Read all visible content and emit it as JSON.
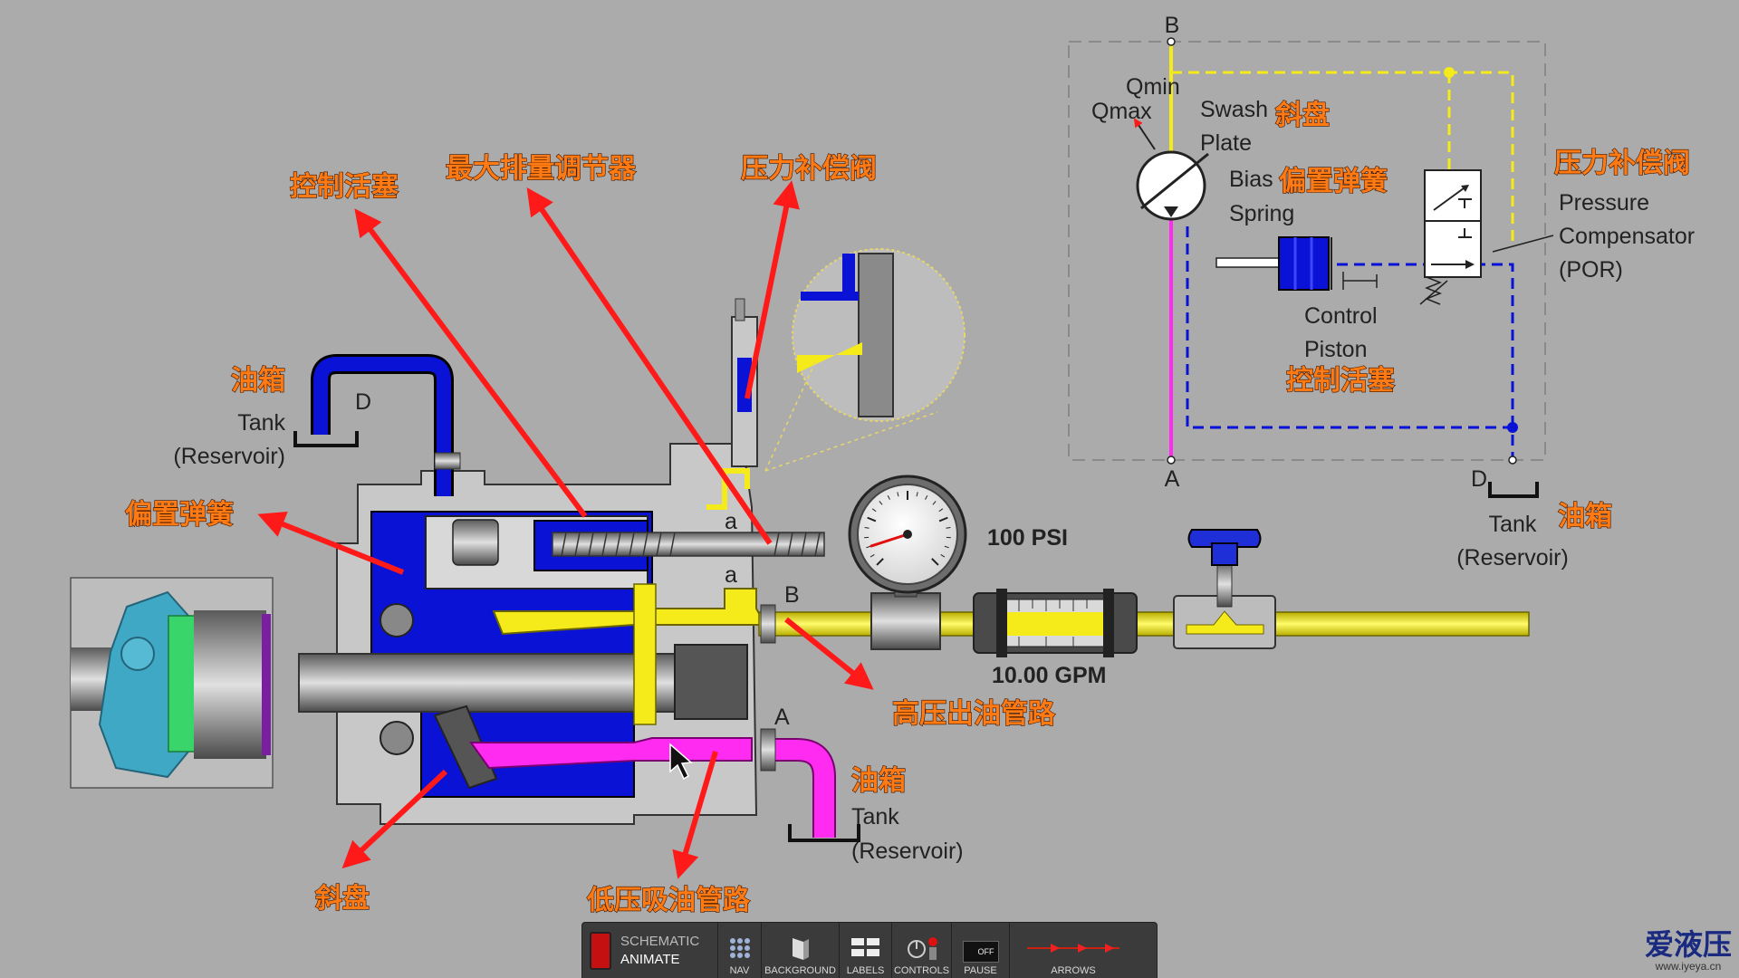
{
  "schematic": {
    "port_b": "B",
    "q_min": "Qmin",
    "q_max": "Qmax",
    "swash_plate_line1": "Swash",
    "swash_plate_line2": "Plate",
    "bias_spring_line1": "Bias",
    "bias_spring_line2": "Spring",
    "control_piston_line1": "Control",
    "control_piston_line2": "Piston",
    "compensator_line1": "Pressure",
    "compensator_line2": "Compensator",
    "compensator_line3": "(POR)",
    "port_a": "A",
    "port_d": "D",
    "tank_line1": "Tank",
    "tank_line2": "(Reservoir)"
  },
  "labels_cn": {
    "swash_plate": "斜盘",
    "bias_spring": "偏置弹簧",
    "control_piston": "控制活塞",
    "compensator": "压力补偿阀",
    "max_displacement": "最大排量调节器",
    "tank": "油箱",
    "high_pressure_line": "高压出油管路",
    "low_pressure_line": "低压吸油管路"
  },
  "pump": {
    "tank_port": "D",
    "tank_line1": "Tank",
    "tank_line2": "(Reservoir)",
    "port_b": "B",
    "port_a": "A",
    "port_a_small": "a",
    "port_a_small2": "a",
    "outlet_tank_line1": "Tank",
    "outlet_tank_line2": "(Reservoir)"
  },
  "gauge": {
    "pressure_text": "100 PSI",
    "psi": 100
  },
  "flowmeter": {
    "flow_text": "10.00 GPM"
  },
  "toolbar": {
    "schematic": "SCHEMATIC",
    "animate": "ANIMATE",
    "nav": "NAV",
    "background": "BACKGROUND",
    "labels": "LABELS",
    "controls": "CONTROLS",
    "pause": "PAUSE",
    "pause_state": "OFF",
    "arrows": "ARROWS"
  },
  "branding": {
    "logo": "爱液压",
    "url": "www.iyeya.cn"
  },
  "colors": {
    "pressure_yellow": "#f5ea1a",
    "suction_magenta": "#ff2bf0",
    "case_blue": "#0a12d6",
    "callout_orange": "#ff7a12",
    "arrow_red": "#ff1a1a"
  }
}
